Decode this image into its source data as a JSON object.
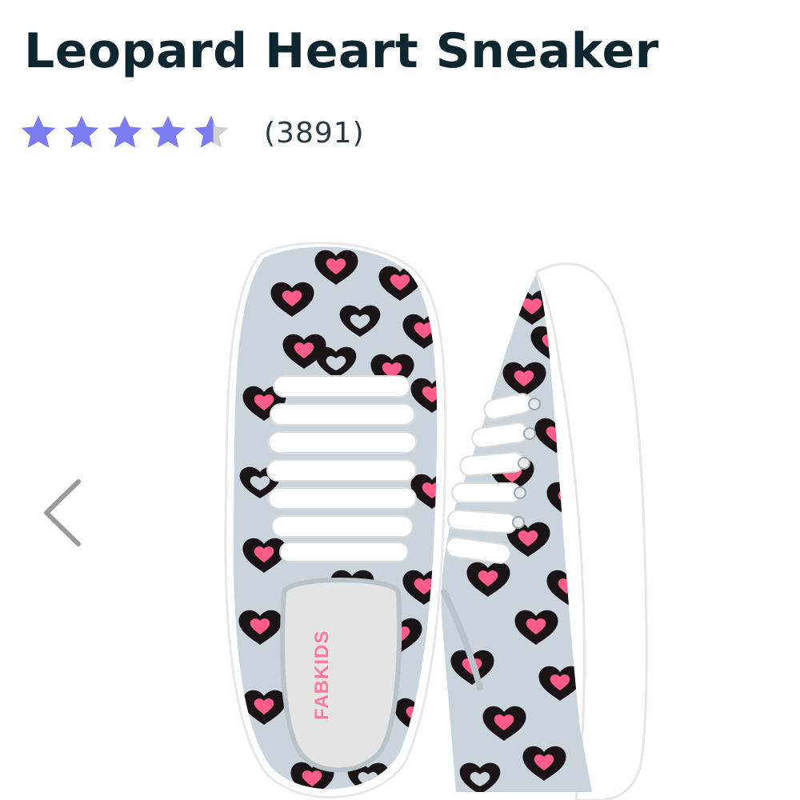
{
  "product": {
    "title": "Leopard Heart Sneaker",
    "rating": {
      "value": 4.6,
      "max": 5,
      "review_count": "(3891)",
      "star_color": "#7b7cf2",
      "star_empty_color": "#d0d0d0"
    },
    "image": {
      "brand_label": "FABKIDS",
      "colors": {
        "canvas": "#c9d4dc",
        "spots": "#1b1417",
        "hearts": "#ff5c8a",
        "sole": "#ffffff",
        "insole": "#e4e4e4"
      }
    }
  },
  "gallery": {
    "prev_icon": "chevron-left-icon",
    "arrow_color": "#9a9a9a"
  }
}
